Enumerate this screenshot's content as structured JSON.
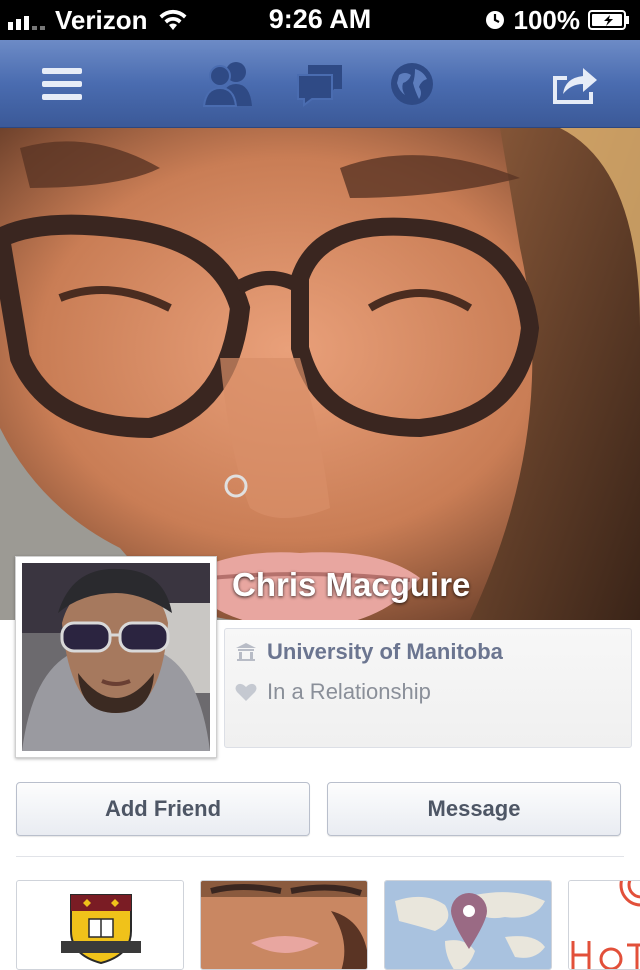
{
  "status": {
    "carrier": "Verizon",
    "time": "9:26 AM",
    "battery": "100%"
  },
  "nav": {
    "icons": [
      "menu-icon",
      "friend-requests-icon",
      "messages-icon",
      "notifications-globe-icon",
      "share-icon"
    ]
  },
  "profile": {
    "name": "Chris Macguire",
    "school": "University of Manitoba",
    "relationship": "In a Relationship"
  },
  "actions": {
    "add_friend": "Add Friend",
    "message": "Message"
  },
  "thumbnails": [
    "university-crest-thumb",
    "photos-thumb",
    "places-map-thumb",
    "likes-thumb"
  ],
  "colors": {
    "navbar": "#3b5998",
    "button_text": "#4e5665"
  }
}
